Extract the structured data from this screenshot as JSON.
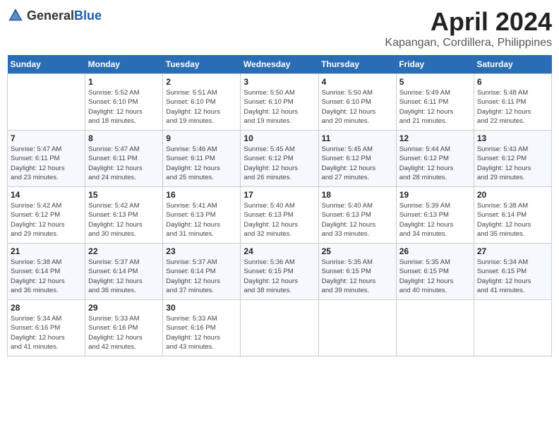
{
  "header": {
    "logo_general": "General",
    "logo_blue": "Blue",
    "month": "April 2024",
    "location": "Kapangan, Cordillera, Philippines"
  },
  "columns": [
    "Sunday",
    "Monday",
    "Tuesday",
    "Wednesday",
    "Thursday",
    "Friday",
    "Saturday"
  ],
  "weeks": [
    [
      {
        "day": "",
        "info": ""
      },
      {
        "day": "1",
        "info": "Sunrise: 5:52 AM\nSunset: 6:10 PM\nDaylight: 12 hours\nand 18 minutes."
      },
      {
        "day": "2",
        "info": "Sunrise: 5:51 AM\nSunset: 6:10 PM\nDaylight: 12 hours\nand 19 minutes."
      },
      {
        "day": "3",
        "info": "Sunrise: 5:50 AM\nSunset: 6:10 PM\nDaylight: 12 hours\nand 19 minutes."
      },
      {
        "day": "4",
        "info": "Sunrise: 5:50 AM\nSunset: 6:10 PM\nDaylight: 12 hours\nand 20 minutes."
      },
      {
        "day": "5",
        "info": "Sunrise: 5:49 AM\nSunset: 6:11 PM\nDaylight: 12 hours\nand 21 minutes."
      },
      {
        "day": "6",
        "info": "Sunrise: 5:48 AM\nSunset: 6:11 PM\nDaylight: 12 hours\nand 22 minutes."
      }
    ],
    [
      {
        "day": "7",
        "info": "Sunrise: 5:47 AM\nSunset: 6:11 PM\nDaylight: 12 hours\nand 23 minutes."
      },
      {
        "day": "8",
        "info": "Sunrise: 5:47 AM\nSunset: 6:11 PM\nDaylight: 12 hours\nand 24 minutes."
      },
      {
        "day": "9",
        "info": "Sunrise: 5:46 AM\nSunset: 6:11 PM\nDaylight: 12 hours\nand 25 minutes."
      },
      {
        "day": "10",
        "info": "Sunrise: 5:45 AM\nSunset: 6:12 PM\nDaylight: 12 hours\nand 26 minutes."
      },
      {
        "day": "11",
        "info": "Sunrise: 5:45 AM\nSunset: 6:12 PM\nDaylight: 12 hours\nand 27 minutes."
      },
      {
        "day": "12",
        "info": "Sunrise: 5:44 AM\nSunset: 6:12 PM\nDaylight: 12 hours\nand 28 minutes."
      },
      {
        "day": "13",
        "info": "Sunrise: 5:43 AM\nSunset: 6:12 PM\nDaylight: 12 hours\nand 29 minutes."
      }
    ],
    [
      {
        "day": "14",
        "info": "Sunrise: 5:42 AM\nSunset: 6:12 PM\nDaylight: 12 hours\nand 29 minutes."
      },
      {
        "day": "15",
        "info": "Sunrise: 5:42 AM\nSunset: 6:13 PM\nDaylight: 12 hours\nand 30 minutes."
      },
      {
        "day": "16",
        "info": "Sunrise: 5:41 AM\nSunset: 6:13 PM\nDaylight: 12 hours\nand 31 minutes."
      },
      {
        "day": "17",
        "info": "Sunrise: 5:40 AM\nSunset: 6:13 PM\nDaylight: 12 hours\nand 32 minutes."
      },
      {
        "day": "18",
        "info": "Sunrise: 5:40 AM\nSunset: 6:13 PM\nDaylight: 12 hours\nand 33 minutes."
      },
      {
        "day": "19",
        "info": "Sunrise: 5:39 AM\nSunset: 6:13 PM\nDaylight: 12 hours\nand 34 minutes."
      },
      {
        "day": "20",
        "info": "Sunrise: 5:38 AM\nSunset: 6:14 PM\nDaylight: 12 hours\nand 35 minutes."
      }
    ],
    [
      {
        "day": "21",
        "info": "Sunrise: 5:38 AM\nSunset: 6:14 PM\nDaylight: 12 hours\nand 36 minutes."
      },
      {
        "day": "22",
        "info": "Sunrise: 5:37 AM\nSunset: 6:14 PM\nDaylight: 12 hours\nand 36 minutes."
      },
      {
        "day": "23",
        "info": "Sunrise: 5:37 AM\nSunset: 6:14 PM\nDaylight: 12 hours\nand 37 minutes."
      },
      {
        "day": "24",
        "info": "Sunrise: 5:36 AM\nSunset: 6:15 PM\nDaylight: 12 hours\nand 38 minutes."
      },
      {
        "day": "25",
        "info": "Sunrise: 5:35 AM\nSunset: 6:15 PM\nDaylight: 12 hours\nand 39 minutes."
      },
      {
        "day": "26",
        "info": "Sunrise: 5:35 AM\nSunset: 6:15 PM\nDaylight: 12 hours\nand 40 minutes."
      },
      {
        "day": "27",
        "info": "Sunrise: 5:34 AM\nSunset: 6:15 PM\nDaylight: 12 hours\nand 41 minutes."
      }
    ],
    [
      {
        "day": "28",
        "info": "Sunrise: 5:34 AM\nSunset: 6:16 PM\nDaylight: 12 hours\nand 41 minutes."
      },
      {
        "day": "29",
        "info": "Sunrise: 5:33 AM\nSunset: 6:16 PM\nDaylight: 12 hours\nand 42 minutes."
      },
      {
        "day": "30",
        "info": "Sunrise: 5:33 AM\nSunset: 6:16 PM\nDaylight: 12 hours\nand 43 minutes."
      },
      {
        "day": "",
        "info": ""
      },
      {
        "day": "",
        "info": ""
      },
      {
        "day": "",
        "info": ""
      },
      {
        "day": "",
        "info": ""
      }
    ]
  ]
}
